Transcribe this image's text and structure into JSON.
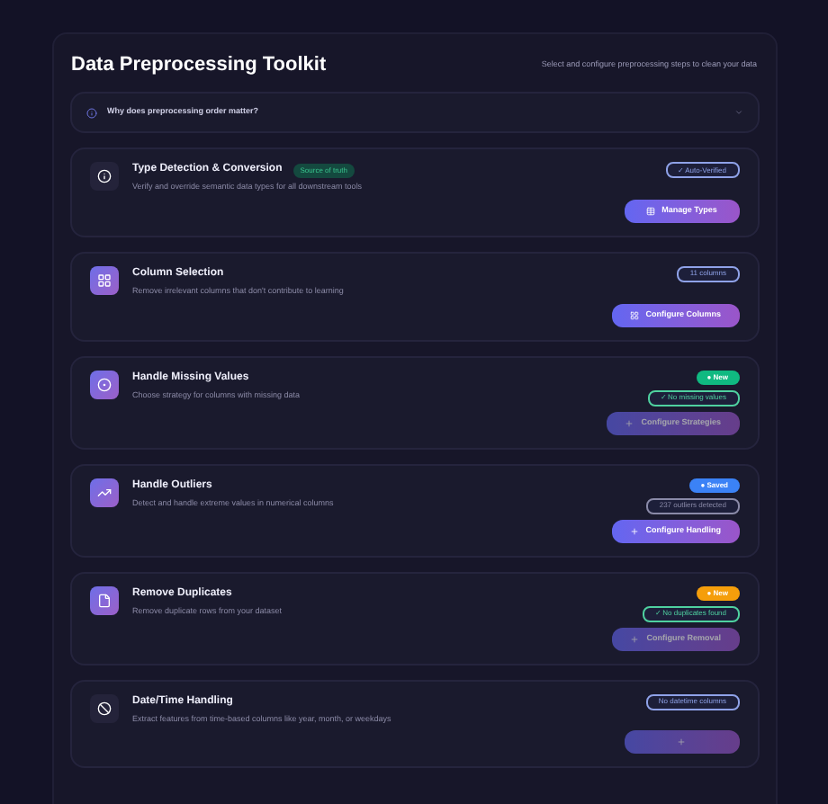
{
  "header": {
    "title": "Data Preprocessing Toolkit",
    "subtitle": "Select and configure preprocessing steps to clean your data"
  },
  "info_accordion": {
    "question": "Why does preprocessing order matter?",
    "expanded": false
  },
  "steps": [
    {
      "title": "Type Detection & Conversion",
      "tag": "Source of truth",
      "description": "Verify and override semantic data types for all downstream tools",
      "badges": [
        {
          "text": "✓ Auto-Verified",
          "kind": "outline",
          "color": "#8fa2e8"
        }
      ],
      "button": {
        "label": "Manage Types",
        "disabled": false
      }
    },
    {
      "title": "Column Selection",
      "description": "Remove irrelevant columns that don't contribute to learning",
      "badges": [
        {
          "text": "11 columns",
          "kind": "outline",
          "color": "#8fa2e8"
        }
      ],
      "button": {
        "label": "Configure Columns",
        "disabled": false
      }
    },
    {
      "title": "Handle Missing Values",
      "description": "Choose strategy for columns with missing data",
      "badges": [
        {
          "text": "● New",
          "kind": "pill",
          "color": "#10b981"
        },
        {
          "text": "✓ No missing values",
          "kind": "outline",
          "color": "#4fd1a0"
        }
      ],
      "button": {
        "label": "Configure Strategies",
        "disabled": true
      }
    },
    {
      "title": "Handle Outliers",
      "description": "Detect and handle extreme values in numerical columns",
      "badges": [
        {
          "text": "● Saved",
          "kind": "pill",
          "color": "#3b82f6"
        },
        {
          "text": "237 outliers detected",
          "kind": "outline",
          "color": "#8a8aa8"
        }
      ],
      "button": {
        "label": "Configure Handling",
        "disabled": false
      }
    },
    {
      "title": "Remove Duplicates",
      "description": "Remove duplicate rows from your dataset",
      "badges": [
        {
          "text": "● New",
          "kind": "pill",
          "color": "#f59e0b"
        },
        {
          "text": "✓ No duplicates found",
          "kind": "outline",
          "color": "#4fd1a0"
        }
      ],
      "button": {
        "label": "Configure Removal",
        "disabled": true
      }
    },
    {
      "title": "Date/Time Handling",
      "description": "Extract features from time-based columns like year, month, or weekdays",
      "badges": [
        {
          "text": "No datetime columns",
          "kind": "outline",
          "color": "#8fa2e8"
        }
      ],
      "button": {
        "disabled": true
      }
    }
  ]
}
